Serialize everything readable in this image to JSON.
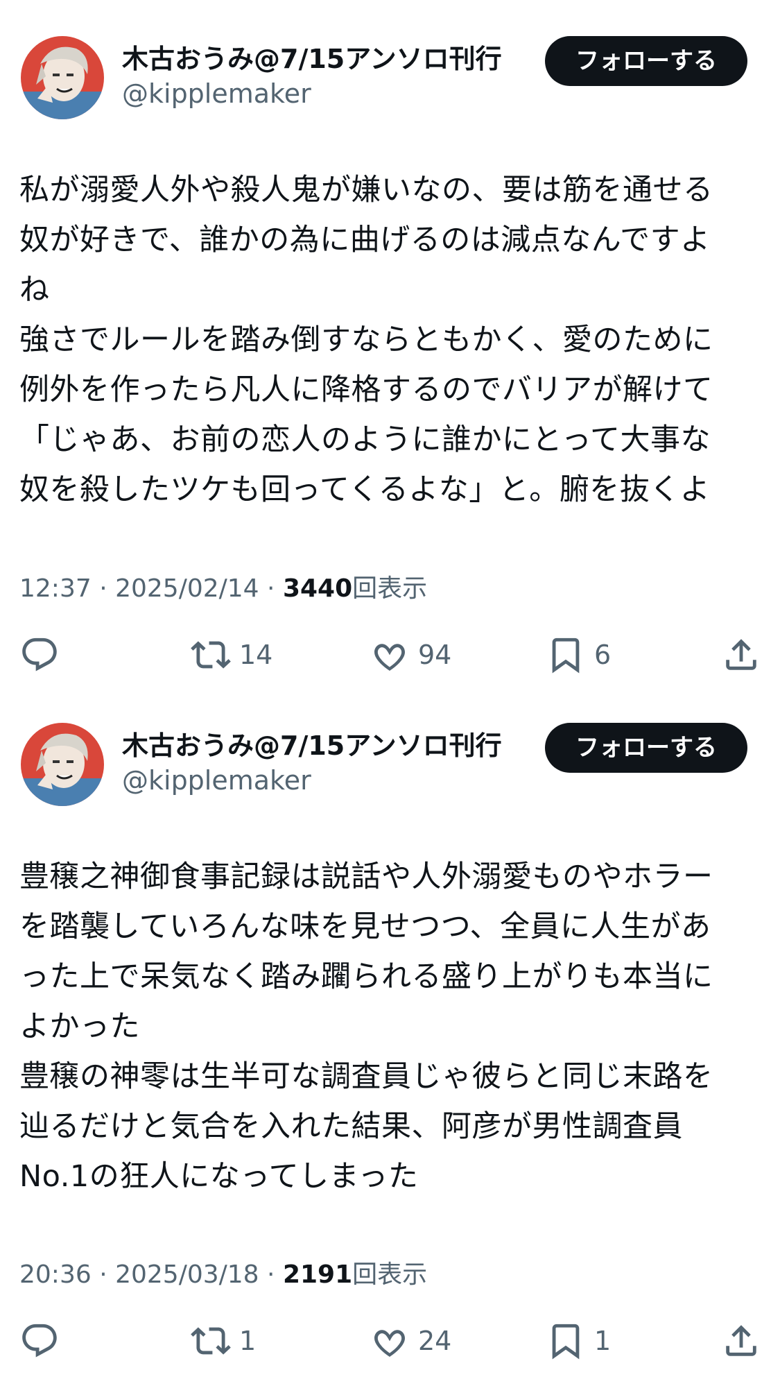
{
  "tweets": [
    {
      "author": {
        "display_name": "木古おうみ@7/15アンソロ刊行",
        "handle": "@kipplemaker",
        "avatar_icon": "avatar-image"
      },
      "follow_label": "フォローする",
      "text": "私が溺愛人外や殺人鬼が嫌いなの、要は筋を通せる\n奴が好きで、誰かの為に曲げるのは減点なんですよ\nね\n強さでルールを踏み倒すならともかく、愛のために\n例外を作ったら凡人に降格するのでバリアが解けて\n「じゃあ、お前の恋人のように誰かにとって大事な\n奴を殺したツケも回ってくるよな」と。腑を抜くよ",
      "time": "12:37",
      "date": "2025/02/14",
      "views": "3440",
      "views_label": "回表示",
      "separator": " · ",
      "actions": {
        "reply_icon": "reply-icon",
        "retweets": "14",
        "likes": "94",
        "bookmarks": "6",
        "share_icon": "share-icon"
      }
    },
    {
      "author": {
        "display_name": "木古おうみ@7/15アンソロ刊行",
        "handle": "@kipplemaker",
        "avatar_icon": "avatar-image"
      },
      "follow_label": "フォローする",
      "text": "豊穣之神御食事記録は説話や人外溺愛ものやホラー\nを踏襲していろんな味を見せつつ、全員に人生があ\nった上で呆気なく踏み躙られる盛り上がりも本当に\nよかった\n豊穣の神零は生半可な調査員じゃ彼らと同じ末路を\n辿るだけと気合を入れた結果、阿彦が男性調査員\nNo.1の狂人になってしまった",
      "time": "20:36",
      "date": "2025/03/18",
      "views": "2191",
      "views_label": "回表示",
      "separator": " · ",
      "actions": {
        "reply_icon": "reply-icon",
        "retweets": "1",
        "likes": "24",
        "bookmarks": "1",
        "share_icon": "share-icon"
      }
    }
  ],
  "colors": {
    "text": "#0f1419",
    "secondary": "#536471",
    "button_bg": "#0f1419",
    "button_text": "#ffffff",
    "avatar_bg": "#d9473a"
  }
}
